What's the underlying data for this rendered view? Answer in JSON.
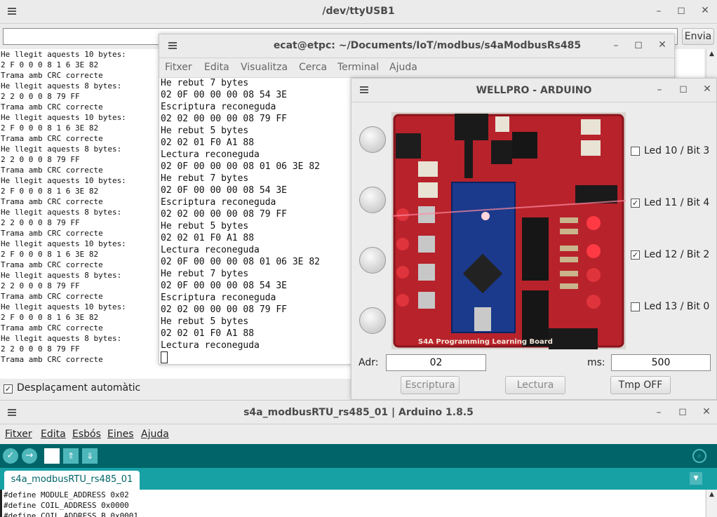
{
  "serial": {
    "title": "/dev/ttyUSB1",
    "send_label": "Envia",
    "input_value": "",
    "lines": [
      "He llegit aquests 10 bytes:",
      "2 F 0 0 0 8 1 6 3E 82",
      "Trama amb CRC correcte",
      "He llegit aquests 8 bytes:",
      "2 2 0 0 0 8 79 FF",
      "Trama amb CRC correcte",
      "He llegit aquests 10 bytes:",
      "2 F 0 0 0 8 1 6 3E 82",
      "Trama amb CRC correcte",
      "He llegit aquests 8 bytes:",
      "2 2 0 0 0 8 79 FF",
      "Trama amb CRC correcte",
      "He llegit aquests 10 bytes:",
      "2 F 0 0 0 8 1 6 3E 82",
      "Trama amb CRC correcte",
      "He llegit aquests 8 bytes:",
      "2 2 0 0 0 8 79 FF",
      "Trama amb CRC correcte",
      "He llegit aquests 10 bytes:",
      "2 F 0 0 0 8 1 6 3E 82",
      "Trama amb CRC correcte",
      "He llegit aquests 8 bytes:",
      "2 2 0 0 0 8 79 FF",
      "Trama amb CRC correcte",
      "He llegit aquests 10 bytes:",
      "2 F 0 0 0 8 1 6 3E 82",
      "Trama amb CRC correcte",
      "He llegit aquests 8 bytes:",
      "2 2 0 0 0 8 79 FF",
      "Trama amb CRC correcte"
    ],
    "autoscroll_label": "Desplaçament automàtic",
    "autoscroll_checked": true
  },
  "terminal": {
    "title": "ecat@etpc: ~/Documents/IoT/modbus/s4aModbusRs485",
    "menu": [
      "Fitxer",
      "Edita",
      "Visualitza",
      "Cerca",
      "Terminal",
      "Ajuda"
    ],
    "lines": [
      "He rebut 7 bytes",
      "02 0F 00 00 00 08 54 3E",
      "Escriptura reconeguda",
      "02 02 00 00 00 08 79 FF",
      "He rebut 5 bytes",
      "02 02 01 F0 A1 88",
      "Lectura reconeguda",
      "02 0F 00 00 00 08 01 06 3E 82",
      "He rebut 7 bytes",
      "02 0F 00 00 00 08 54 3E",
      "Escriptura reconeguda",
      "02 02 00 00 00 08 79 FF",
      "He rebut 5 bytes",
      "02 02 01 F0 A1 88",
      "Lectura reconeguda",
      "02 0F 00 00 00 08 01 06 3E 82",
      "He rebut 7 bytes",
      "02 0F 00 00 00 08 54 3E",
      "Escriptura reconeguda",
      "02 02 00 00 00 08 79 FF",
      "He rebut 5 bytes",
      "02 02 01 F0 A1 88",
      "Lectura reconeguda"
    ]
  },
  "wellpro": {
    "title": "WELLPRO - ARDUINO",
    "leds": [
      {
        "label": "Led 10 / Bit 3",
        "checked": false
      },
      {
        "label": "Led 11 / Bit 4",
        "checked": true
      },
      {
        "label": "Led 12 / Bit 2",
        "checked": true
      },
      {
        "label": "Led 13 / Bit 0",
        "checked": false
      }
    ],
    "adr_label": "Adr:",
    "adr_value": "02",
    "ms_label": "ms:",
    "ms_value": "500",
    "btn_escriptura": "Escriptura",
    "btn_lectura": "Lectura",
    "btn_tmp": "Tmp OFF",
    "board_silkscreen": "S4A Programming Learning Board"
  },
  "arduino": {
    "title": "s4a_modbusRTU_rs485_01 | Arduino 1.8.5",
    "menu": [
      "Fitxer",
      "Edita",
      "Esbós",
      "Eines",
      "Ajuda"
    ],
    "tab": "s4a_modbusRTU_rs485_01",
    "code": [
      "#define MODULE_ADDRESS 0x02",
      "#define COIL_ADDRESS 0x0000",
      "#define COIL_ADDRESS_B 0x0001"
    ],
    "colors": {
      "teal_dark": "#006468",
      "teal": "#17a1a5",
      "toolbar": "#00979c"
    }
  }
}
